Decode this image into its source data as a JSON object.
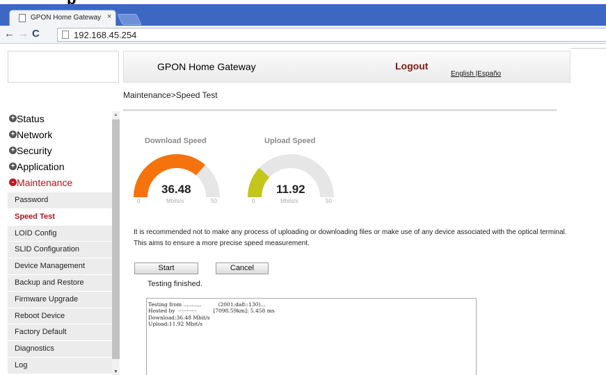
{
  "browser": {
    "tab_title": "GPON Home Gateway",
    "tab_close": "×",
    "url": "192.168.45.254"
  },
  "header": {
    "title": "GPON Home Gateway",
    "logout": "Logout",
    "language": "English |Españo"
  },
  "breadcrumb": "Maintenance>Speed Test",
  "sidebar": {
    "menus": [
      {
        "label": "Status",
        "state": "+"
      },
      {
        "label": "Network",
        "state": "+"
      },
      {
        "label": "Security",
        "state": "+"
      },
      {
        "label": "Application",
        "state": "+"
      },
      {
        "label": "Maintenance",
        "state": "-"
      }
    ],
    "items": [
      {
        "label": "Password"
      },
      {
        "label": "Speed Test"
      },
      {
        "label": "LOID Config"
      },
      {
        "label": "SLID Configuration"
      },
      {
        "label": "Device Management"
      },
      {
        "label": "Backup and Restore"
      },
      {
        "label": "Firmware Upgrade"
      },
      {
        "label": "Reboot Device"
      },
      {
        "label": "Factory Default"
      },
      {
        "label": "Diagnostics"
      },
      {
        "label": "Log"
      }
    ]
  },
  "gauges": {
    "download": {
      "label": "Download Speed",
      "value": "36.48",
      "fill": 0.7296,
      "unit": "Mbits/s",
      "min": "0",
      "max": "50",
      "color": "#f6720d"
    },
    "upload": {
      "label": "Upload Speed",
      "value": "11.92",
      "fill": 0.2384,
      "unit": "Mbits/s",
      "min": "0",
      "max": "50",
      "color": "#c4c61b"
    }
  },
  "notice": {
    "line1": "It is recommended not to make any process of uploading or downloading files or make use of any device associated with the optical terminal.",
    "line2": "This aims to ensure a more precise speed measurement."
  },
  "buttons": {
    "start": "Start",
    "cancel": "Cancel"
  },
  "status": "Testing finished.",
  "console": {
    "line1": "Testing from ...........          (2001:da8::130)...",
    "line2": "Hosted by  ···········          [7098.59km]: 5.458 ms",
    "line3": "Download:36.48 Mbit/s",
    "line4": "Upload:11.92 Mbit/s"
  },
  "colors": {
    "accent": "#b0151c",
    "track": "#e6e6e6"
  }
}
